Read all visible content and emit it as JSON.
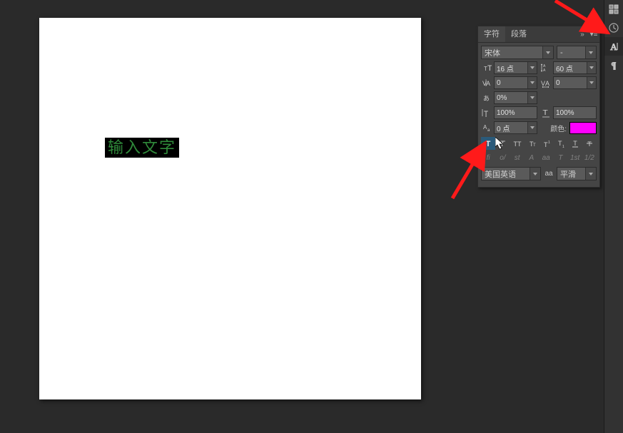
{
  "canvas": {
    "text": "输入文字"
  },
  "rightbar": {
    "items": [
      "swatches",
      "history",
      "character",
      "paragraph"
    ]
  },
  "panel": {
    "tabs": {
      "char": "字符",
      "para": "段落"
    },
    "fontFamily": "宋体",
    "fontStyle": "-",
    "fontSize": "16 点",
    "leading": "60 点",
    "kerning": "0",
    "tracking": "0",
    "baseline": "0%",
    "vScale": "100%",
    "hScale": "100%",
    "baselineShift": "0 点",
    "colorLabel": "颜色:",
    "color": "#ff00ff",
    "language": "美国英语",
    "antialias": "平滑",
    "aaLabel": "aa",
    "styleButtons": [
      "faux-bold",
      "faux-italic",
      "allcaps",
      "smallcaps",
      "superscript",
      "subscript",
      "underline",
      "strikethrough"
    ],
    "otButtons": [
      "fi",
      "o/",
      "st",
      "A",
      "aa",
      "T",
      "1st",
      "1/2"
    ]
  }
}
